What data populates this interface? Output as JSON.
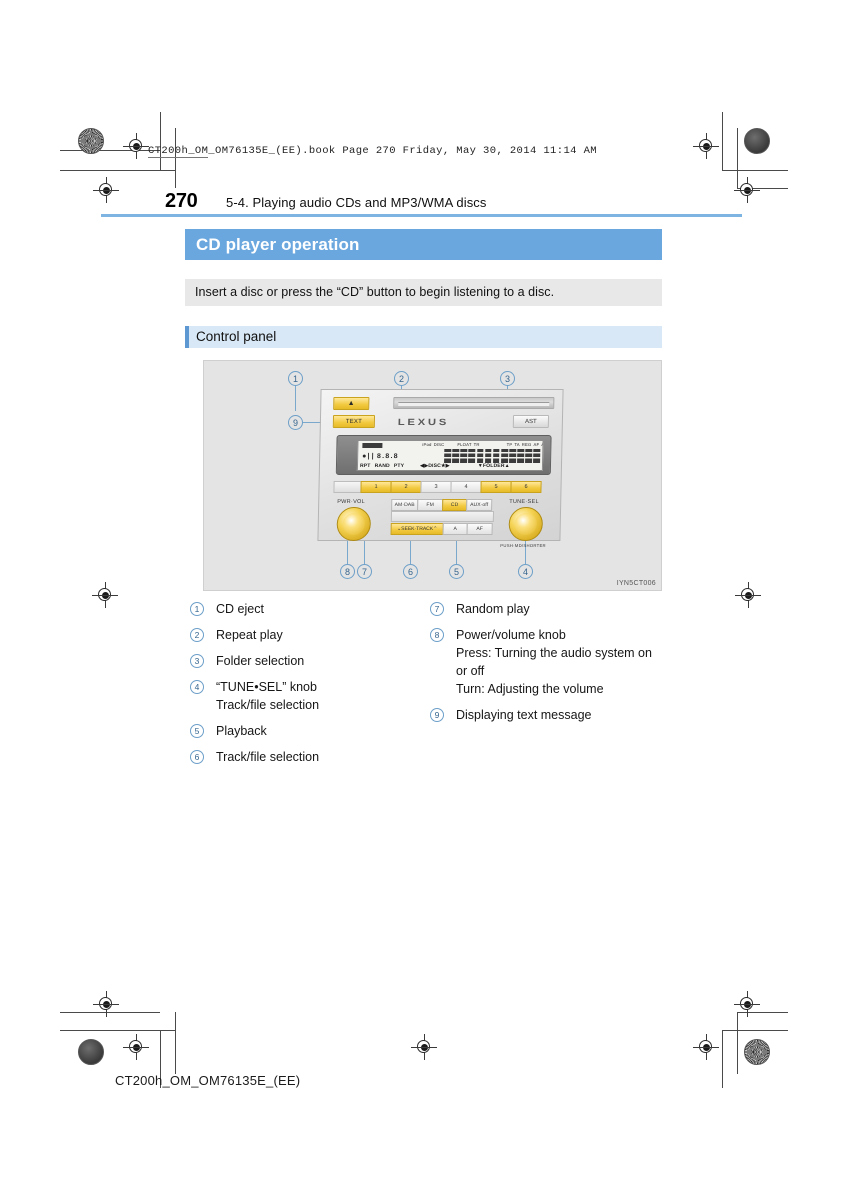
{
  "print_marks": {
    "book_line": "CT200h_OM_OM76135E_(EE).book  Page 270  Friday, May 30, 2014  11:14 AM",
    "footer_id": "CT200h_OM_OM76135E_(EE)"
  },
  "header": {
    "page_number": "270",
    "section": "5-4. Playing audio CDs and MP3/WMA discs",
    "rule_color": "#7eb4e2"
  },
  "section": {
    "title": "CD player operation",
    "title_bg": "#6aa7de",
    "intro": "Insert a disc or press the “CD” button to begin listening to a disc.",
    "intro_bg": "#e8e8e8",
    "subsection": "Control panel",
    "subsection_bg": "#d8e8f6",
    "subsection_tick": "#5d98d3"
  },
  "figure": {
    "id_label": "IYN5CT006",
    "brand": "LEXUS",
    "buttons": {
      "eject": "▲",
      "text": "TEXT",
      "ast": "AST"
    },
    "presets": [
      "1",
      "2",
      "3",
      "4",
      "5",
      "6"
    ],
    "preset_highlighted": [
      "1",
      "2",
      "5",
      "6"
    ],
    "sources": [
      "AM·DAB",
      "FM",
      "CD",
      "AUX·off"
    ],
    "source_selected": "CD",
    "seek_row": [
      "⌄SEEK·TRACK⌃",
      "A",
      "AF"
    ],
    "seek_highlighted": "⌄SEEK·TRACK⌃",
    "knobs": {
      "left_label": "PWR·VOL",
      "right_label": "TUNE·SEL",
      "right_sub": "PUSH·MD/SHORTER"
    },
    "lcd": {
      "top_indicators": [
        "iPod",
        "DISC",
        "FLOAT",
        "TR",
        "TP",
        "TA",
        "REG",
        "AF",
        "AUTO"
      ],
      "bottom_indicators": [
        "RAND",
        "PTY",
        "DISC",
        "FOLDER",
        "RA"
      ],
      "left_side": [
        "RPT",
        "PCM"
      ]
    },
    "callouts": [
      "1",
      "2",
      "3",
      "4",
      "5",
      "6",
      "7",
      "8",
      "9"
    ],
    "callout_color": "#36658e"
  },
  "legend": {
    "left": [
      {
        "num": "1",
        "lines": [
          "CD eject"
        ]
      },
      {
        "num": "2",
        "lines": [
          "Repeat play"
        ]
      },
      {
        "num": "3",
        "lines": [
          "Folder selection"
        ]
      },
      {
        "num": "4",
        "lines": [
          "“TUNE•SEL” knob",
          "Track/file selection"
        ]
      },
      {
        "num": "5",
        "lines": [
          "Playback"
        ]
      },
      {
        "num": "6",
        "lines": [
          "Track/file selection"
        ]
      }
    ],
    "right": [
      {
        "num": "7",
        "lines": [
          "Random play"
        ]
      },
      {
        "num": "8",
        "lines": [
          "Power/volume knob",
          "Press: Turning the audio system on",
          "or off",
          "Turn: Adjusting the volume"
        ]
      },
      {
        "num": "9",
        "lines": [
          "Displaying text message"
        ]
      }
    ]
  }
}
